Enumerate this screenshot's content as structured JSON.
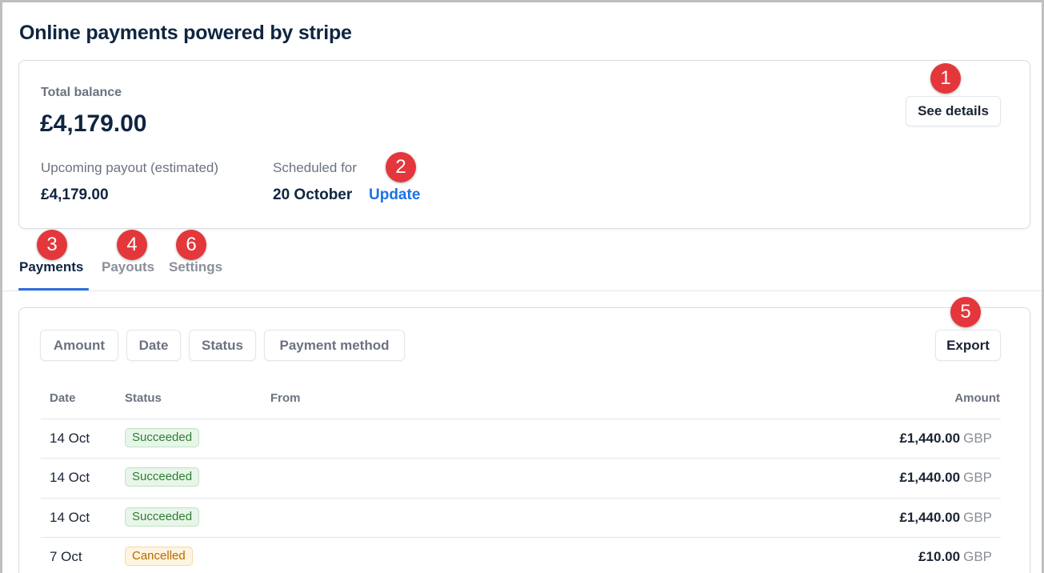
{
  "page": {
    "title": "Online payments powered by stripe"
  },
  "balance": {
    "label": "Total balance",
    "value": "£4,179.00",
    "see_details_label": "See details",
    "payout_label": "Upcoming payout (estimated)",
    "payout_value": "£4,179.00",
    "scheduled_label": "Scheduled for",
    "scheduled_value": "20 October",
    "update_label": "Update"
  },
  "tabs": [
    {
      "label": "Payments",
      "active": true
    },
    {
      "label": "Payouts",
      "active": false
    },
    {
      "label": "Settings",
      "active": false
    }
  ],
  "filters": [
    "Amount",
    "Date",
    "Status",
    "Payment method"
  ],
  "export_label": "Export",
  "table": {
    "headers": {
      "date": "Date",
      "status": "Status",
      "from": "From",
      "amount": "Amount"
    },
    "rows": [
      {
        "date": "14 Oct",
        "status": "Succeeded",
        "from": "",
        "amount": "£1,440.00",
        "currency": "GBP"
      },
      {
        "date": "14 Oct",
        "status": "Succeeded",
        "from": "",
        "amount": "£1,440.00",
        "currency": "GBP"
      },
      {
        "date": "14 Oct",
        "status": "Succeeded",
        "from": "",
        "amount": "£1,440.00",
        "currency": "GBP"
      },
      {
        "date": "7 Oct",
        "status": "Cancelled",
        "from": "",
        "amount": "£10.00",
        "currency": "GBP"
      }
    ]
  },
  "annotations": [
    "1",
    "2",
    "3",
    "4",
    "6",
    "5"
  ],
  "colors": {
    "accent": "#2f6fde",
    "link": "#1a73e8",
    "marker": "#e4373b",
    "success": "#2e7d32",
    "cancelled": "#b26a00"
  }
}
